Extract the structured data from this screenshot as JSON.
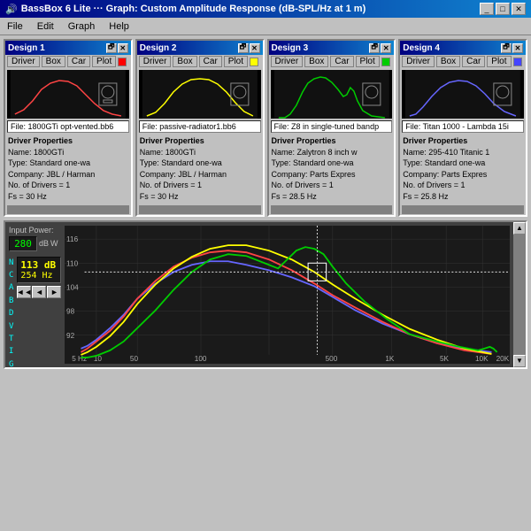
{
  "window": {
    "title": "BassBox 6 Lite ··· Graph: Custom Amplitude Response (dB-SPL/Hz at 1 m)",
    "minimize": "_",
    "maximize": "□",
    "close": "✕"
  },
  "menu": {
    "items": [
      "File",
      "Edit",
      "Graph",
      "Help"
    ]
  },
  "designs": [
    {
      "title": "Design 1",
      "tabs": [
        "Driver",
        "Box",
        "Car"
      ],
      "plot_label": "Plot",
      "color": "#ff0000",
      "file": "File: 1800GTi opt-vented.bb6",
      "driver_label": "Driver Properties",
      "name": "Name: 1800GTi",
      "type": "Type: Standard one-wa",
      "company": "Company: JBL / Harman",
      "drivers": "No. of Drivers = 1",
      "fs": "Fs = 30 Hz"
    },
    {
      "title": "Design 2",
      "tabs": [
        "Driver",
        "Box",
        "Car"
      ],
      "plot_label": "Plot",
      "color": "#ffff00",
      "file": "File: passive-radiator1.bb6",
      "driver_label": "Driver Properties",
      "name": "Name: 1800GTi",
      "type": "Type: Standard one-wa",
      "company": "Company: JBL / Harman",
      "drivers": "No. of Drivers = 1",
      "fs": "Fs = 30 Hz"
    },
    {
      "title": "Design 3",
      "tabs": [
        "Driver",
        "Box",
        "Car"
      ],
      "plot_label": "Plot",
      "color": "#00ff00",
      "file": "File: Z8 in single-tuned bandp",
      "driver_label": "Driver Properties",
      "name": "Name: Zalytron 8 inch w",
      "type": "Type: Standard one-wa",
      "company": "Company: Parts Expres",
      "drivers": "No. of Drivers = 1",
      "fs": "Fs = 28.5 Hz"
    },
    {
      "title": "Design 4",
      "tabs": [
        "Driver",
        "Box",
        "Car"
      ],
      "plot_label": "Plot",
      "color": "#0000ff",
      "file": "File: Titan 1000 - Lambda 15i",
      "driver_label": "Driver Properties",
      "name": "Name: 295-410 Titanic 1",
      "type": "Type: Standard one-wa",
      "company": "Company: Parts Expres",
      "drivers": "No. of Drivers = 1",
      "fs": "Fs = 25.8 Hz"
    }
  ],
  "bottom": {
    "input_power_label": "Input Power:",
    "db_label": "dB",
    "w_label": "W",
    "power_value": "280",
    "letters": [
      "N",
      "C",
      "A",
      "B",
      "D",
      "V",
      "T",
      "I",
      "G"
    ],
    "display_db": "113 dB",
    "display_hz": "254 Hz",
    "nav_left2": "◄◄",
    "nav_left1": "◄",
    "nav_right1": "►",
    "nav_right2": "►►",
    "graph": {
      "y_labels": [
        "116",
        "110",
        "104",
        "98",
        "92"
      ],
      "x_labels": [
        "5 Hz",
        "10",
        "50",
        "100",
        "500",
        "1K",
        "5K",
        "10K",
        "20K"
      ]
    }
  }
}
